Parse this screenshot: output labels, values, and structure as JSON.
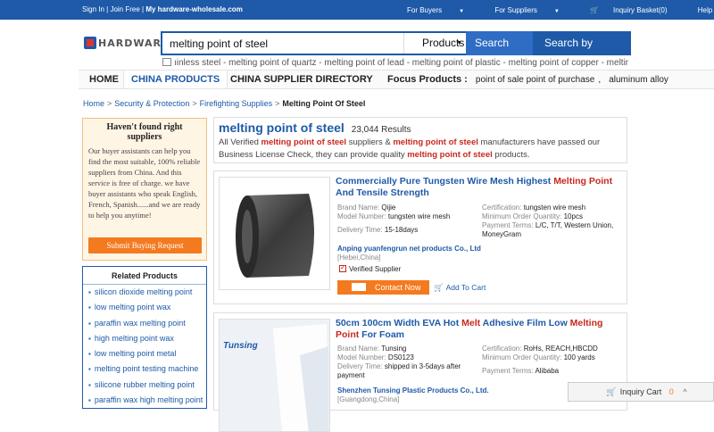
{
  "topbar": {
    "sign_in": "Sign In",
    "join_free": "Join Free",
    "my_site": "My hardware-wholesale.com",
    "for_buyers": "For Buyers",
    "for_suppliers": "For Suppliers",
    "inquiry_basket": "Inquiry Basket(0)",
    "help": "Help"
  },
  "logo": {
    "text": "HARDWARE"
  },
  "search": {
    "query": "melting point of steel",
    "category": "Products",
    "search_label": "Search",
    "search_by_category_label": "Search by Category"
  },
  "suggestions": "ıinless steel - melting point of quartz - melting point of lead - melting point of plastic - melting point of copper - melting point of b",
  "nav": {
    "home": "HOME",
    "china_products": "CHINA PRODUCTS",
    "china_supplier_directory": "CHINA SUPPLIER DIRECTORY",
    "focus_label": "Focus Products :",
    "focus_items": [
      "point of sale point of purchase",
      "aluminum alloy"
    ]
  },
  "breadcrumb": {
    "home": "Home",
    "security": "Security & Protection",
    "firefighting": "Firefighting Supplies",
    "current": "Melting Point Of Steel"
  },
  "buyer_box": {
    "heading": "Haven't found right suppliers",
    "text": "Our buyer assistants can help you find the most suitable, 100% reliable suppliers from China. And this service is free of charge. we have buyer assistants who speak English, French, Spanish......and we are ready to help you anytime!",
    "button": "Submit Buying Request"
  },
  "related": {
    "heading": "Related Products",
    "items": [
      "silicon dioxide melting point",
      "low melting point wax",
      "paraffin wax melting point",
      "high melting point wax",
      "low melting point metal",
      "melting point testing machine",
      "silicone rubber melting point",
      "paraffin wax high melting point"
    ]
  },
  "results": {
    "title": "melting point of steel",
    "count": "23,044 Results",
    "desc_1": "All Verified",
    "desc_kw": "melting point of steel",
    "desc_2": "suppliers &",
    "desc_3": "manufacturers have passed our Business License Check, they can provide quality",
    "desc_4": "products."
  },
  "products": [
    {
      "title_parts": [
        "Commercially Pure Tungsten Wire Mesh Highest ",
        "Melting Point",
        " And Tensile Strength"
      ],
      "brand_label": "Brand Name:",
      "brand": "Qijie",
      "model_label": "Model Number:",
      "model": "tungsten wire mesh",
      "delivery_label": "Delivery Time:",
      "delivery": "15-18days",
      "cert_label": "Certification:",
      "cert": "tungsten wire mesh",
      "moq_label": "Minimum Order Quantity:",
      "moq": "10pcs",
      "pay_label": "Payment Terms:",
      "pay": "L/C, T/T, Western Union, MoneyGram",
      "company": "Anping yuanfengrun net products Co., Ltd",
      "location": "[Hebei,China]",
      "verified": "Verified Supplier",
      "contact": "Contact Now",
      "add_to_cart": "Add To Cart"
    },
    {
      "title_parts": [
        "50cm 100cm Width EVA Hot ",
        "Melt",
        " Adhesive Film Low ",
        "Melting Point",
        " For Foam"
      ],
      "brand_label": "Brand Name:",
      "brand": "Tunsing",
      "model_label": "Model Number:",
      "model": "DS0123",
      "delivery_label": "Delivery Time:",
      "delivery": "shipped in 3-5days after payment",
      "cert_label": "Certification:",
      "cert": "RoHs, REACH,HBCDD",
      "moq_label": "Minimum Order Quantity:",
      "moq": "100 yards",
      "pay_label": "Payment Terms:",
      "pay": "Alibaba",
      "company": "Shenzhen Tunsing Plastic Products Co., Ltd.",
      "location": "[Guangdong,China]",
      "image_brand": "Tunsing"
    }
  ],
  "inquiry_cart": {
    "label": "Inquiry Cart",
    "count": "0"
  }
}
